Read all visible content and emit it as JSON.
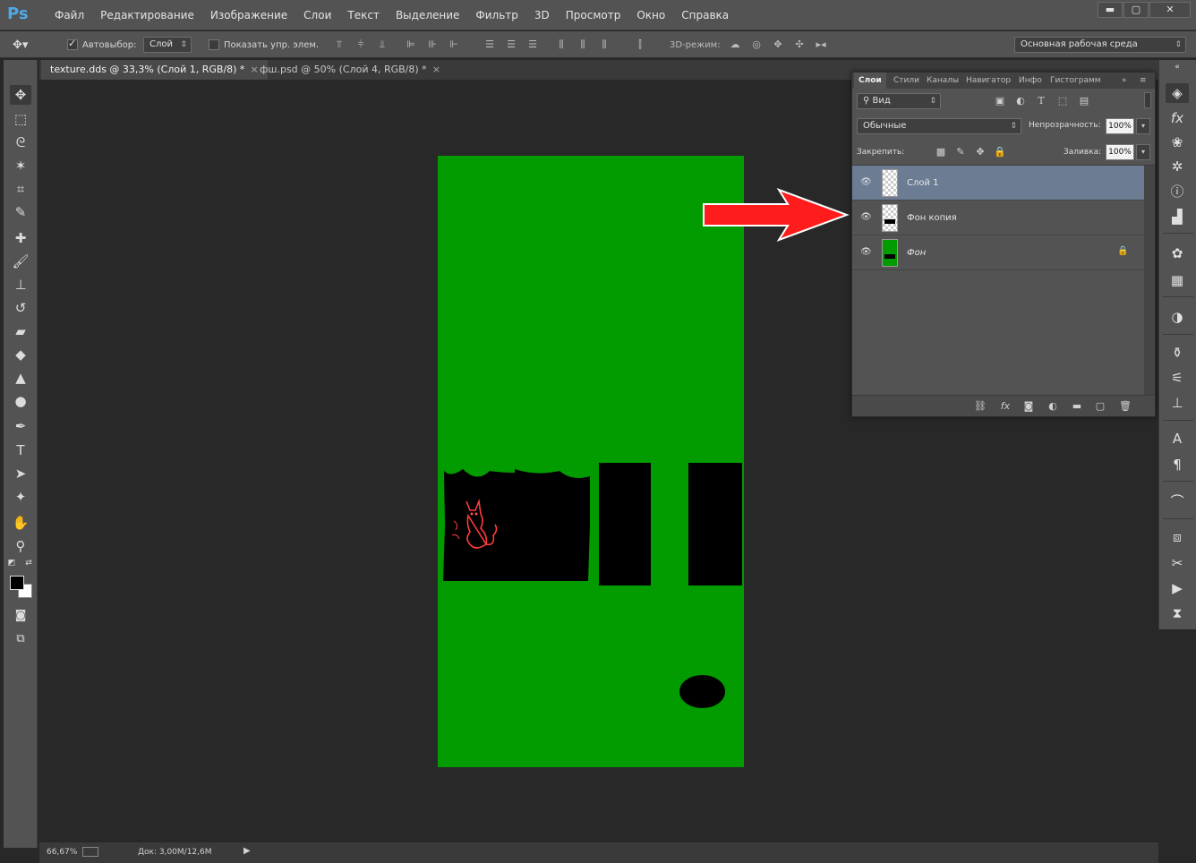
{
  "app": {
    "logo": "Ps"
  },
  "menu": [
    "Файл",
    "Редактирование",
    "Изображение",
    "Слои",
    "Текст",
    "Выделение",
    "Фильтр",
    "3D",
    "Просмотр",
    "Окно",
    "Справка"
  ],
  "window_controls": {
    "minimize": "▬",
    "maximize": "▢",
    "close": "✕"
  },
  "options": {
    "autoselect_label": "Автовыбор:",
    "autoselect_checked": true,
    "autoselect_target": "Слой",
    "show_controls_label": "Показать упр. элем.",
    "show_controls_checked": false,
    "mode_3d_label": "3D-режим:",
    "workspace": "Основная рабочая среда"
  },
  "tabs": [
    {
      "label": "texture.dds @ 33,3% (Слой 1, RGB/8) *",
      "close": "×",
      "active": true
    },
    {
      "label": "фш.psd @ 50% (Слой 4, RGB/8) *",
      "close": "×",
      "active": false
    }
  ],
  "tools": [
    {
      "name": "move-tool-icon",
      "glyph": "✥"
    },
    {
      "name": "marquee-tool-icon",
      "glyph": "⬚"
    },
    {
      "name": "lasso-tool-icon",
      "glyph": "ᘓ"
    },
    {
      "name": "magic-wand-tool-icon",
      "glyph": "✶"
    },
    {
      "name": "crop-tool-icon",
      "glyph": "⌗"
    },
    {
      "name": "eyedropper-tool-icon",
      "glyph": "✎"
    },
    {
      "name": "healing-brush-tool-icon",
      "glyph": "✚"
    },
    {
      "name": "brush-tool-icon",
      "glyph": "🖌"
    },
    {
      "name": "clone-stamp-tool-icon",
      "glyph": "⊥"
    },
    {
      "name": "history-brush-tool-icon",
      "glyph": "↺"
    },
    {
      "name": "eraser-tool-icon",
      "glyph": "▰"
    },
    {
      "name": "paint-bucket-tool-icon",
      "glyph": "◆"
    },
    {
      "name": "blur-tool-icon",
      "glyph": "▲"
    },
    {
      "name": "dodge-tool-icon",
      "glyph": "●"
    },
    {
      "name": "pen-tool-icon",
      "glyph": "✒"
    },
    {
      "name": "type-tool-icon",
      "glyph": "T"
    },
    {
      "name": "path-selection-tool-icon",
      "glyph": "➤"
    },
    {
      "name": "shape-tool-icon",
      "glyph": "✦"
    },
    {
      "name": "hand-tool-icon",
      "glyph": "✋"
    },
    {
      "name": "zoom-tool-icon",
      "glyph": "⚲"
    }
  ],
  "layers_panel": {
    "tabs": [
      "Слои",
      "Стили",
      "Каналы",
      "Навигатор",
      "Инфо",
      "Гистограмм"
    ],
    "filter_kind": "Вид",
    "blend_mode": "Обычные",
    "opacity_label": "Непрозрачность:",
    "opacity_value": "100%",
    "lock_label": "Закрепить:",
    "fill_label": "Заливка:",
    "fill_value": "100%",
    "layers": [
      {
        "name": "Слой 1",
        "selected": true,
        "thumb": "transparent",
        "locked": false
      },
      {
        "name": "Фон копия",
        "selected": false,
        "thumb": "transparent-black",
        "locked": false
      },
      {
        "name": "Фон",
        "selected": false,
        "thumb": "green",
        "locked": true
      }
    ]
  },
  "status": {
    "zoom": "66,67%",
    "doc": "Док: 3,00M/12,6M"
  },
  "colors": {
    "document_green": "#029b00",
    "selected_layer": "#6b7c93",
    "arrow_red": "#ff1c1c"
  }
}
